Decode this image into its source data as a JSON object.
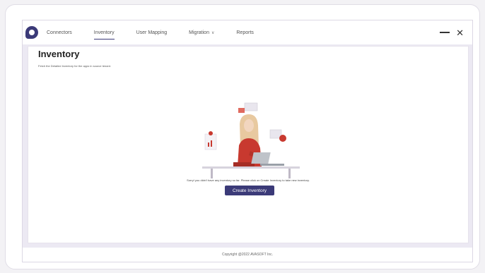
{
  "nav": {
    "items": [
      {
        "label": "Connectors",
        "active": false
      },
      {
        "label": "Inventory",
        "active": true
      },
      {
        "label": "User Mapping",
        "active": false
      },
      {
        "label": "Migration",
        "active": false,
        "has_dropdown": true
      },
      {
        "label": "Reports",
        "active": false
      }
    ]
  },
  "window": {
    "minimize_icon": "minimize-icon",
    "close_icon": "close-icon",
    "close_glyph": "✕"
  },
  "page": {
    "title": "Inventory",
    "subtitle": "Fetch the Detailed Inventory for the apps in source tenant."
  },
  "empty_state": {
    "message": "Sorry! you didn't have any inventory so far. Please click on Create Inventory to take new inventory.",
    "button_label": "Create Inventory"
  },
  "footer": {
    "copyright": "Copyright @2022 AVASOFT Inc."
  },
  "colors": {
    "brand": "#3b3a78",
    "illustration_accent": "#c8392f"
  }
}
